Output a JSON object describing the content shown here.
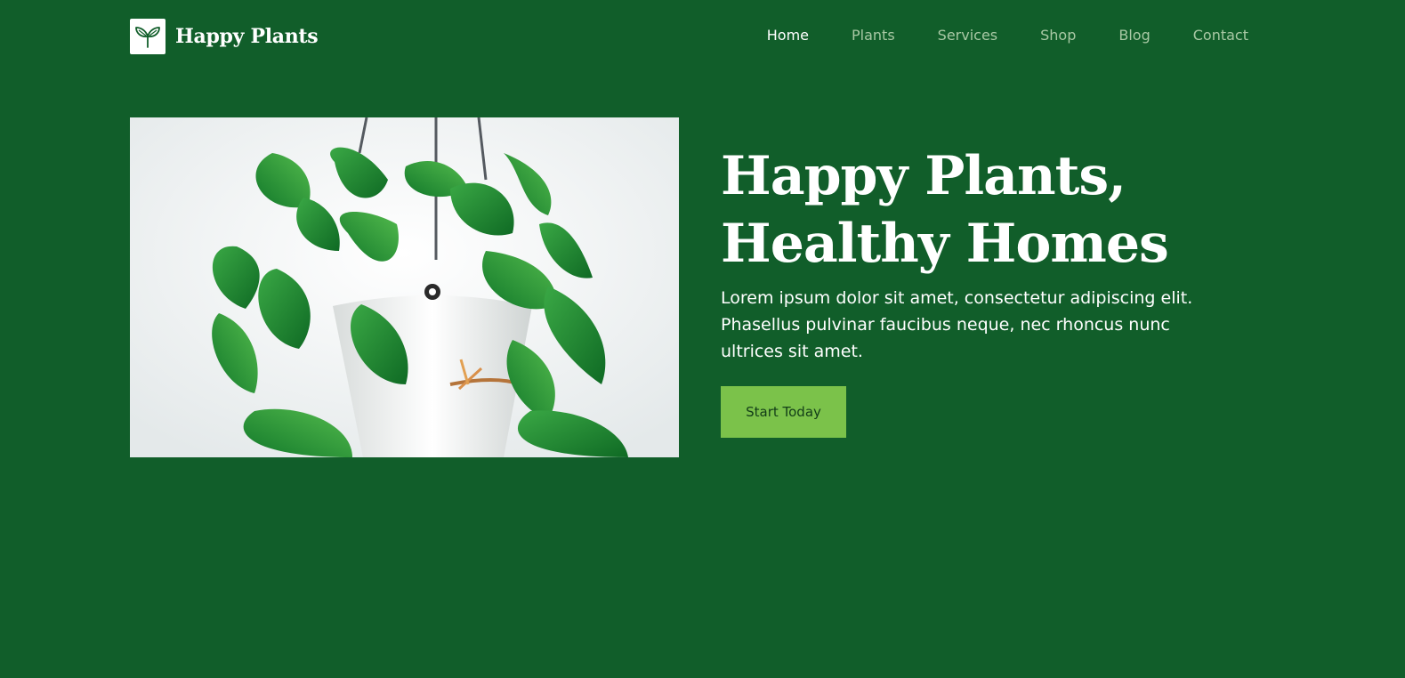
{
  "brand": {
    "name": "Happy Plants",
    "logo_icon": "sprout-icon"
  },
  "nav": {
    "items": [
      {
        "label": "Home",
        "active": true
      },
      {
        "label": "Plants",
        "active": false
      },
      {
        "label": "Services",
        "active": false
      },
      {
        "label": "Shop",
        "active": false
      },
      {
        "label": "Blog",
        "active": false
      },
      {
        "label": "Contact",
        "active": false
      }
    ]
  },
  "hero": {
    "image_subject": "hanging-pothos-plant-photo",
    "headline_line1": "Happy Plants,",
    "headline_line2": "Healthy Homes",
    "lead": "Lorem ipsum dolor sit amet, consectetur adipiscing elit. Phasellus pulvinar faucibus neque, nec rhoncus nunc ultrices sit amet.",
    "cta_label": "Start Today"
  },
  "colors": {
    "background": "#115e2a",
    "accent": "#7bc24a",
    "nav_inactive": "#a8c8a4",
    "text": "#ffffff"
  }
}
